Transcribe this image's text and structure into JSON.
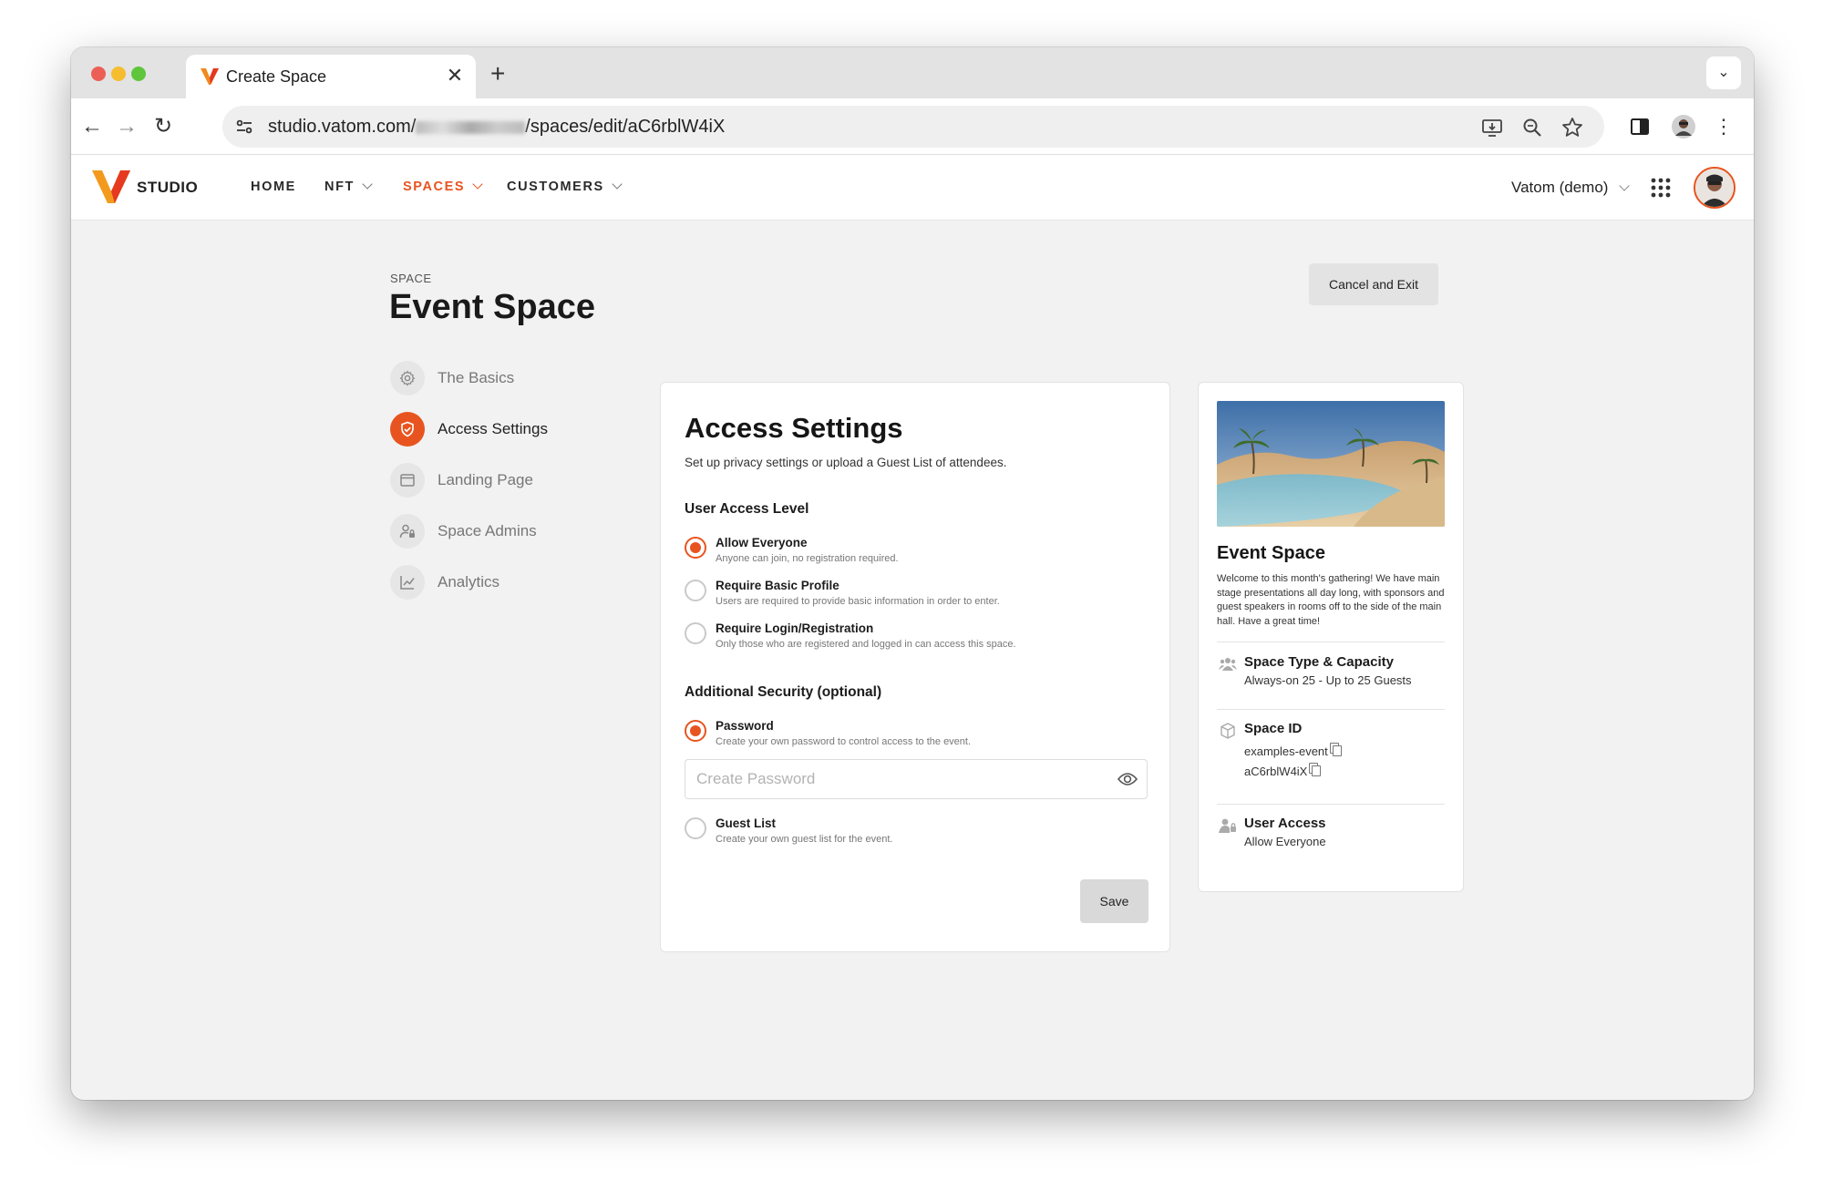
{
  "browser": {
    "tab_title": "Create Space",
    "url_prefix": "studio.vatom.com/",
    "url_suffix": "/spaces/edit/aC6rblW4iX"
  },
  "header": {
    "logo_text": "STUDIO",
    "nav": [
      {
        "label": "HOME"
      },
      {
        "label": "NFT"
      },
      {
        "label": "SPACES"
      },
      {
        "label": "CUSTOMERS"
      }
    ],
    "org_name": "Vatom (demo)"
  },
  "page": {
    "eyebrow": "SPACE",
    "title": "Event Space",
    "cancel_label": "Cancel and Exit"
  },
  "sidebar": {
    "items": [
      {
        "label": "The Basics",
        "icon": "gear-icon"
      },
      {
        "label": "Access Settings",
        "icon": "shield-icon"
      },
      {
        "label": "Landing Page",
        "icon": "browser-window-icon"
      },
      {
        "label": "Space Admins",
        "icon": "user-lock-icon"
      },
      {
        "label": "Analytics",
        "icon": "chart-line-icon"
      }
    ]
  },
  "access": {
    "title": "Access Settings",
    "subtitle": "Set up privacy settings or upload a Guest List of attendees.",
    "user_access_heading": "User Access Level",
    "options": [
      {
        "label": "Allow Everyone",
        "desc": "Anyone can join, no registration required."
      },
      {
        "label": "Require Basic Profile",
        "desc": "Users are required to provide basic information in order to enter."
      },
      {
        "label": "Require Login/Registration",
        "desc": "Only those who are registered and logged in can access this space."
      }
    ],
    "security_heading": "Additional Security (optional)",
    "password": {
      "label": "Password",
      "desc": "Create your own password to control access to the event.",
      "placeholder": "Create Password",
      "value": ""
    },
    "guest_list": {
      "label": "Guest List",
      "desc": "Create your own guest list for the event."
    },
    "save_label": "Save"
  },
  "preview": {
    "title": "Event Space",
    "description": "Welcome to this month's gathering! We have main stage presentations all day long, with sponsors and guest speakers in rooms off to the side of the main hall. Have a great time!",
    "type_heading": "Space Type & Capacity",
    "type_value": "Always-on 25 - Up to 25 Guests",
    "id_heading": "Space ID",
    "id_values": [
      "examples-event",
      "aC6rblW4iX"
    ],
    "access_heading": "User Access",
    "access_value": "Allow Everyone"
  },
  "colors": {
    "accent": "#e8541f"
  }
}
